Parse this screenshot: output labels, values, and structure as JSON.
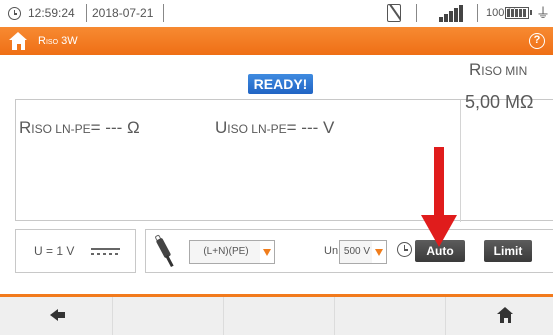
{
  "status_bar": {
    "time": "12:59:24",
    "date": "2018-07-21",
    "battery_percent": "100 %",
    "icons": [
      "clock-icon",
      "no-memory-card-icon",
      "signal-strength-icon",
      "battery-icon",
      "plug-icon"
    ]
  },
  "title_bar": {
    "title_main": "R",
    "title_sub": "ISO",
    "title_suffix": " 3W",
    "help_label": "?",
    "accent_color": "#f17619"
  },
  "status": {
    "ready_label": "READY!",
    "ready_color": "#2a6fd0"
  },
  "results": {
    "r_main": "R",
    "r_sub": "ISO LN-PE",
    "r_value": "= --- Ω",
    "u_main": "U",
    "u_sub": "ISO LN-PE",
    "u_value": "= --- V",
    "rmin_main": "R",
    "rmin_sub": "ISO MIN",
    "rmin_value": "5,00 MΩ"
  },
  "voltage_panel": {
    "label": "U = 1 V",
    "icon": "dc-symbol-icon"
  },
  "controls": {
    "probe_icon": "probe-adapter-icon",
    "connection_value": "(L+N)(PE)",
    "un_label": "Un",
    "voltage_value": "500 V",
    "timer_icon": "timer-icon",
    "auto_label": "Auto",
    "limit_label": "Limit"
  },
  "annotation": {
    "arrow_color": "#e01c1c",
    "points_to": "auto-button"
  },
  "footer": {
    "back_icon": "back-arrow-icon",
    "home_icon": "home-icon"
  }
}
